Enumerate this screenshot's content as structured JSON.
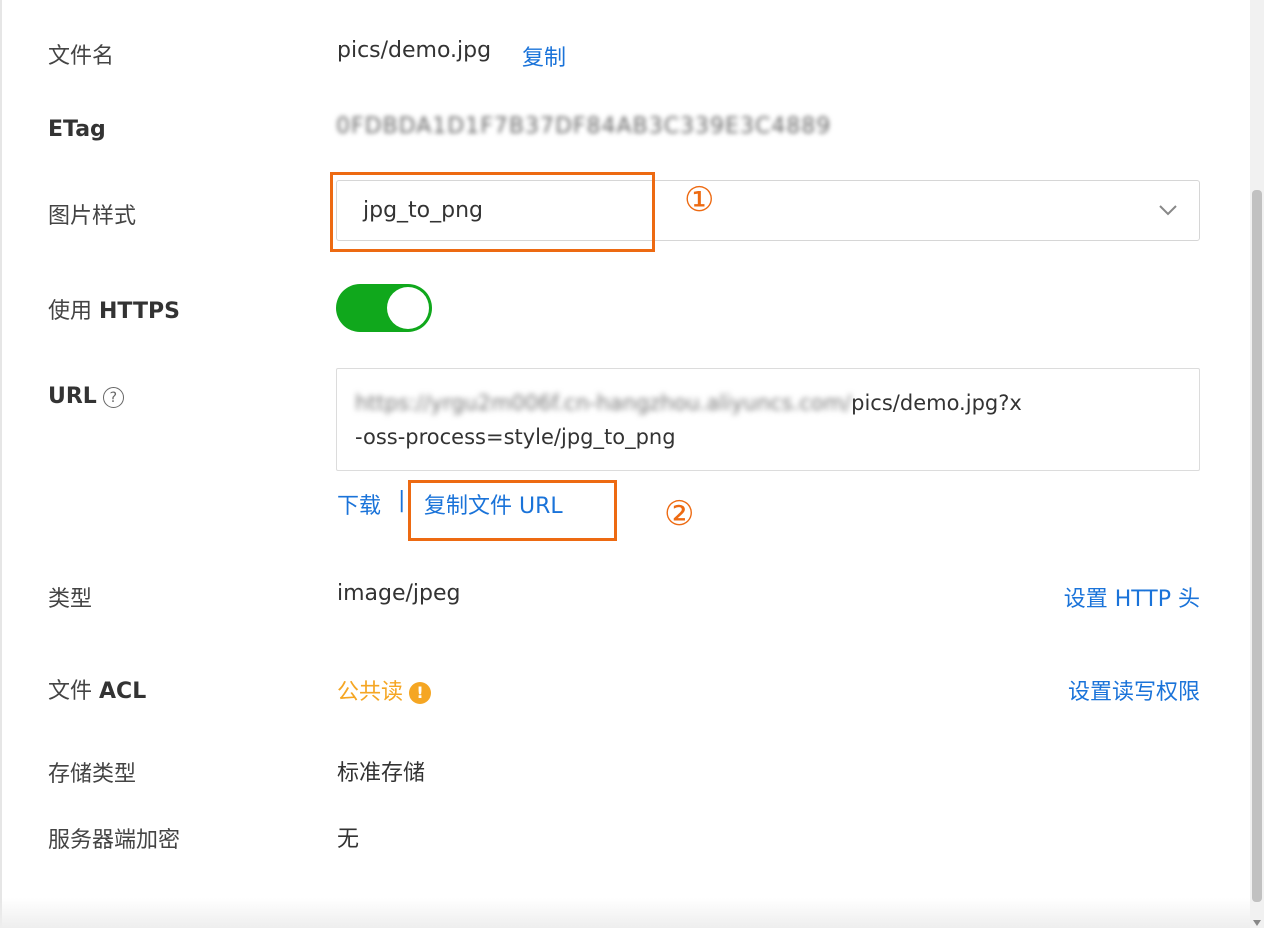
{
  "rows": {
    "filename": {
      "label": "文件名",
      "value": "pics/demo.jpg",
      "copy_link": "复制"
    },
    "etag": {
      "label": "ETag",
      "value": "0FDBDA1D1F7B37DF84AB3C339E3C4889"
    },
    "image_style": {
      "label": "图片样式",
      "selected": "jpg_to_png",
      "chevron_icon": "chevron-down-icon"
    },
    "https": {
      "label_prefix": "使用",
      "label_bold": "HTTPS",
      "enabled": true,
      "toggle_color": "#10a81c"
    },
    "url": {
      "label": "URL",
      "help_symbol": "?",
      "blurred_prefix": "https://yrgu2m006f.cn-hangzhou.aliyuncs.com/",
      "line1_visible": "pics/demo.jpg?x",
      "line2": "-oss-process=style/jpg_to_png",
      "download_link": "下载",
      "separator": "|",
      "copy_url_link": "复制文件 URL"
    },
    "type": {
      "label": "类型",
      "value": "image/jpeg",
      "action_link": "设置 HTTP 头"
    },
    "acl": {
      "label_prefix": "文件",
      "label_bold": "ACL",
      "value": "公共读",
      "value_color": "#f5a623",
      "warn_symbol": "!",
      "action_link": "设置读写权限"
    },
    "storage": {
      "label": "存储类型",
      "value": "标准存储"
    },
    "encryption": {
      "label": "服务器端加密",
      "value": "无"
    }
  },
  "annotations": {
    "marker1": "①",
    "marker2": "②",
    "color": "#ed6a12"
  },
  "link_color": "#1a73d9"
}
